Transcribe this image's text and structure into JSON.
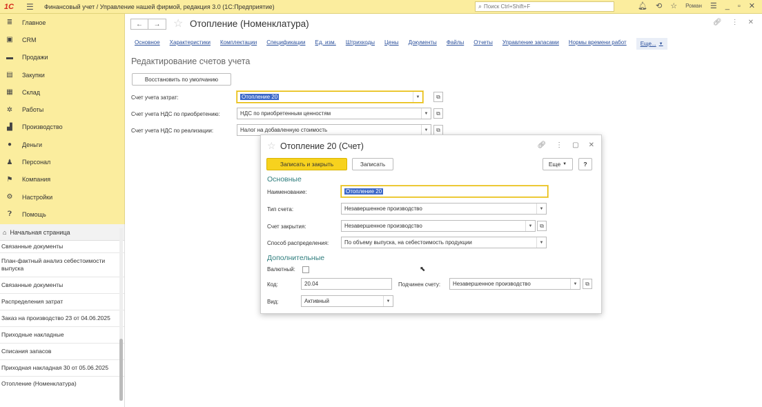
{
  "topbar": {
    "logo": "1С",
    "title": "Финансовый учет / Управление нашей фирмой, редакция 3.0  (1С:Предприятие)",
    "search_placeholder": "Поиск Ctrl+Shift+F",
    "user": "Роман"
  },
  "sidebar": {
    "items": [
      {
        "label": "Главное",
        "icon": "menu-icon"
      },
      {
        "label": "CRM",
        "icon": "crm-icon"
      },
      {
        "label": "Продажи",
        "icon": "sales-icon"
      },
      {
        "label": "Закупки",
        "icon": "purchases-icon"
      },
      {
        "label": "Склад",
        "icon": "warehouse-icon"
      },
      {
        "label": "Работы",
        "icon": "works-icon"
      },
      {
        "label": "Производство",
        "icon": "production-icon"
      },
      {
        "label": "Деньги",
        "icon": "money-icon"
      },
      {
        "label": "Персонал",
        "icon": "staff-icon"
      },
      {
        "label": "Компания",
        "icon": "company-icon"
      },
      {
        "label": "Настройки",
        "icon": "settings-icon"
      },
      {
        "label": "Помощь",
        "icon": "help-icon"
      }
    ]
  },
  "history": {
    "home": "Начальная страница",
    "items": [
      "Связанные документы",
      "План-фактный анализ себестоимости выпуска",
      "Связанные документы",
      "Распределения затрат",
      "Заказ на производство 23 от 04.06.2025",
      "Приходные накладные",
      "Списания запасов",
      "Приходная накладная 30 от 05.06.2025",
      "Отопление (Номенклатура)"
    ]
  },
  "main": {
    "title": "Отопление (Номенклатура)",
    "tabs": [
      "Основное",
      "Характеристики",
      "Комплектации",
      "Спецификации",
      "Ед. изм.",
      "Штрихкоды",
      "Цены",
      "Документы",
      "Файлы",
      "Отчеты",
      "Управление запасами",
      "Нормы времени работ"
    ],
    "tab_more": "Еще...",
    "section_title": "Редактирование счетов учета",
    "restore_button": "Восстановить по умолчанию",
    "rows": [
      {
        "label": "Счет учета затрат:",
        "value": "Отопление 20"
      },
      {
        "label": "Счет учета НДС по приобретению:",
        "value": "НДС по приобретенным ценностям"
      },
      {
        "label": "Счет учета НДС по реализации:",
        "value": "Налог на добавленную стоимость"
      }
    ]
  },
  "modal": {
    "title": "Отопление 20 (Счет)",
    "save_close": "Записать и закрыть",
    "save": "Записать",
    "more": "Еще",
    "help": "?",
    "group_main": "Основные",
    "name_label": "Наименование:",
    "name_value": "Отопление 20",
    "type_label": "Тип счета:",
    "type_value": "Незавершенное производство",
    "close_label": "Счет закрытия:",
    "close_value": "Незавершенное производство",
    "dist_label": "Способ распределения:",
    "dist_value": "По объему выпуска, на себестоимость продукции",
    "group_extra": "Дополнительные",
    "currency_label": "Валютный:",
    "code_label": "Код:",
    "code_value": "20.04",
    "parent_label": "Подчинен счету:",
    "parent_value": "Незавершенное производство",
    "kind_label": "Вид:",
    "kind_value": "Активный"
  }
}
